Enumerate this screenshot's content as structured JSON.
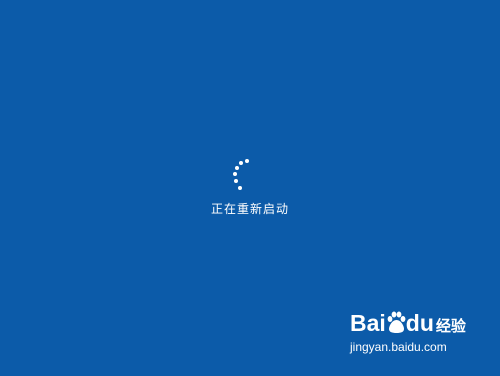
{
  "screen": {
    "background_color": "#0c5ba9",
    "status_text": "正在重新启动",
    "spinner_icon": "loading-spinner-icon"
  },
  "watermark": {
    "logo_text_1": "Bai",
    "logo_text_2": "du",
    "paw_icon": "baidu-paw-icon",
    "label": "经验",
    "url": "jingyan.baidu.com"
  }
}
